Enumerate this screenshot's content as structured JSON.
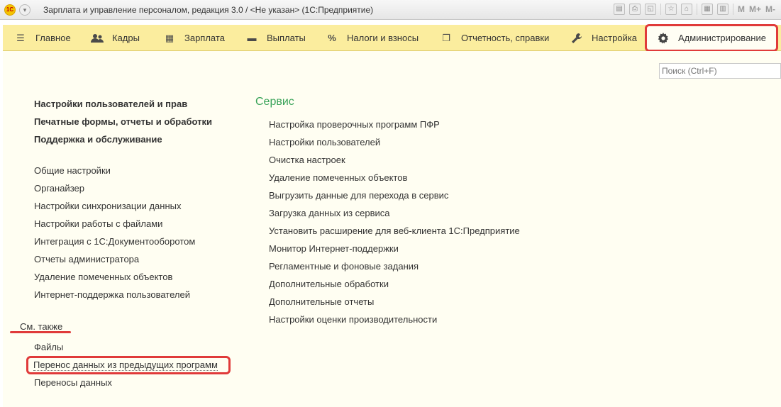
{
  "window": {
    "title": "Зарплата и управление персоналом, редакция 3.0 / <Не указан>  (1С:Предприятие)",
    "logo_text": "1С",
    "toolbar_m": "M",
    "toolbar_mplus": "M+",
    "toolbar_mminus": "M-"
  },
  "sections": [
    {
      "label": "Главное",
      "icon": "hamburger-icon"
    },
    {
      "label": "Кадры",
      "icon": "people-icon"
    },
    {
      "label": "Зарплата",
      "icon": "calculator-icon"
    },
    {
      "label": "Выплаты",
      "icon": "wallet-icon"
    },
    {
      "label": "Налоги и взносы",
      "icon": "percent-icon"
    },
    {
      "label": "Отчетность, справки",
      "icon": "documents-icon"
    },
    {
      "label": "Настройка",
      "icon": "wrench-icon"
    },
    {
      "label": "Администрирование",
      "icon": "gear-icon"
    }
  ],
  "search": {
    "placeholder": "Поиск (Ctrl+F)"
  },
  "left_bold": [
    "Настройки пользователей и прав",
    "Печатные формы, отчеты и обработки",
    "Поддержка и обслуживание"
  ],
  "left_links": [
    "Общие настройки",
    "Органайзер",
    "Настройки синхронизации данных",
    "Настройки работы с файлами",
    "Интеграция с 1С:Документооборотом",
    "Отчеты администратора",
    "Удаление помеченных объектов",
    "Интернет-поддержка пользователей"
  ],
  "see_also": {
    "title": "См. также",
    "items": [
      "Файлы",
      "Перенос данных из предыдущих программ",
      "Переносы данных"
    ]
  },
  "service": {
    "title": "Сервис",
    "items": [
      "Настройка проверочных программ ПФР",
      "Настройки пользователей",
      "Очистка настроек",
      "Удаление помеченных объектов",
      "Выгрузить данные для перехода в сервис",
      "Загрузка данных из сервиса",
      "Установить расширение для веб-клиента 1С:Предприятие",
      "Монитор Интернет-поддержки",
      "Регламентные и фоновые задания",
      "Дополнительные обработки",
      "Дополнительные отчеты",
      "Настройки оценки производительности"
    ]
  },
  "colors": {
    "section_bar": "#fbed9e",
    "content_bg": "#fffef2",
    "highlight": "#e03a3a",
    "group_title": "#3aa35a"
  }
}
